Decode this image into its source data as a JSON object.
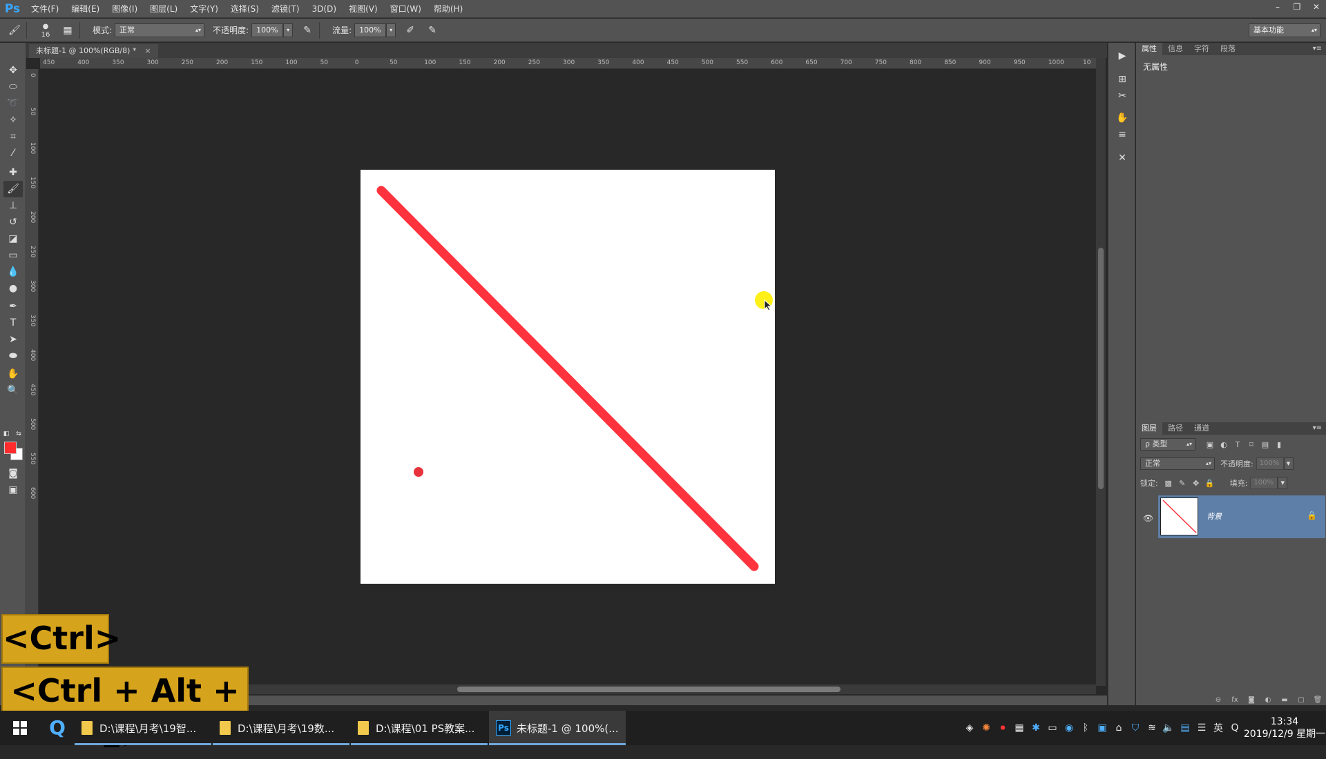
{
  "app": {
    "logo": "Ps"
  },
  "menu": [
    "文件(F)",
    "编辑(E)",
    "图像(I)",
    "图层(L)",
    "文字(Y)",
    "选择(S)",
    "滤镜(T)",
    "3D(D)",
    "视图(V)",
    "窗口(W)",
    "帮助(H)"
  ],
  "window_controls": {
    "minimize": "–",
    "restore": "❐",
    "close": "✕"
  },
  "options": {
    "brush_size": "16",
    "mode_label": "模式:",
    "mode_value": "正常",
    "opacity_label": "不透明度:",
    "opacity_value": "100%",
    "flow_label": "流量:",
    "flow_value": "100%",
    "workspace": "基本功能"
  },
  "document_tab": {
    "title": "未标题-1 @ 100%(RGB/8) *",
    "close": "×"
  },
  "ruler_h": [
    "450",
    "400",
    "350",
    "300",
    "250",
    "200",
    "150",
    "100",
    "50",
    "0",
    "50",
    "100",
    "150",
    "200",
    "250",
    "300",
    "350",
    "400",
    "450",
    "500",
    "550",
    "600",
    "650",
    "700",
    "750",
    "800",
    "850",
    "900",
    "950",
    "1000",
    "10"
  ],
  "ruler_v": [
    "0",
    "50",
    "100",
    "150",
    "200",
    "250",
    "300",
    "350",
    "400",
    "450",
    "500",
    "550",
    "600"
  ],
  "canvas": {
    "background": "#ffffff",
    "stroke_color": "#ff333d",
    "dot_color": "#e8323c"
  },
  "colors": {
    "foreground": "#ff2d2d",
    "background": "#ffffff",
    "cursor_highlight": "#ffee00"
  },
  "properties_panel": {
    "tabs": [
      "属性",
      "信息",
      "字符",
      "段落"
    ],
    "empty_text": "无属性"
  },
  "layers_panel": {
    "tabs": [
      "图层",
      "路径",
      "通道"
    ],
    "filter_label": "ρ 类型",
    "blend_mode": "正常",
    "opacity_label": "不透明度:",
    "opacity_value": "100%",
    "lock_label": "锁定:",
    "fill_label": "填充:",
    "fill_value": "100%",
    "layer_name": "背景"
  },
  "overlays": {
    "ctrl": "<Ctrl>",
    "combo": "<Ctrl + Alt + z>"
  },
  "taskbar": {
    "items": [
      {
        "label": "D:\\课程\\月考\\19智...",
        "type": "folder"
      },
      {
        "label": "D:\\课程\\月考\\19数...",
        "type": "folder"
      },
      {
        "label": "D:\\课程\\01 PS教案...",
        "type": "folder"
      },
      {
        "label": "未标题-1 @ 100%(...",
        "type": "photoshop"
      }
    ],
    "ime": "英",
    "time": "13:34",
    "date": "2019/12/9 星期一"
  }
}
